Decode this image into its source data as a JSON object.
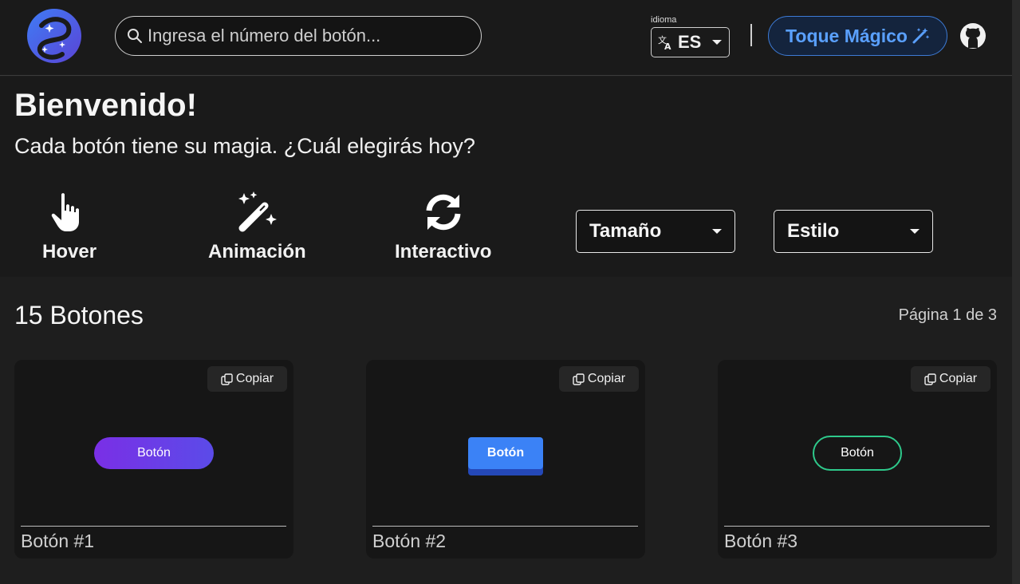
{
  "header": {
    "search_placeholder": "Ingresa el número del botón...",
    "language_label": "idioma",
    "language_code": "ES",
    "magic_button_label": "Toque Mágico",
    "icons": [
      "logo",
      "search-icon",
      "translate-icon",
      "chevron-down-icon",
      "magic-wand-icon",
      "github-icon"
    ],
    "accent_color": "#3d7bd6"
  },
  "welcome": {
    "title": "Bienvenido!",
    "subtitle": "Cada botón tiene su magia. ¿Cuál elegirás hoy?"
  },
  "features": [
    {
      "label": "Hover",
      "icon": "hand-pointer-icon"
    },
    {
      "label": "Animación",
      "icon": "magic-wand-icon"
    },
    {
      "label": "Interactivo",
      "icon": "sync-icon"
    }
  ],
  "filters": {
    "size": "Tamaño",
    "style": "Estilo"
  },
  "list": {
    "count_label": "15 Botones",
    "page_label": "Página 1 de 3"
  },
  "cards": [
    {
      "name": "Botón #1",
      "copy_label": "Copiar",
      "demo_label": "Botón",
      "color": "#7a2fe6"
    },
    {
      "name": "Botón #2",
      "copy_label": "Copiar",
      "demo_label": "Botón",
      "color": "#3b82f6"
    },
    {
      "name": "Botón #3",
      "copy_label": "Copiar",
      "demo_label": "Botón",
      "color": "#2ec98b"
    }
  ]
}
